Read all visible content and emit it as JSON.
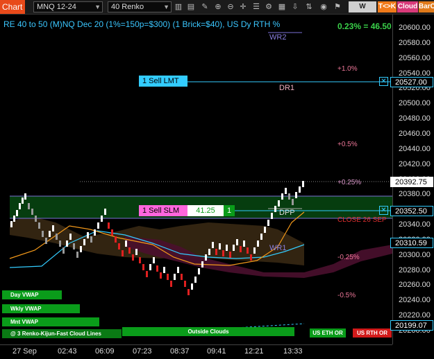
{
  "toolbar": {
    "chart_tab": "Chart",
    "instrument": "MNQ 12-24",
    "bar_type": "40 Renko",
    "buttons": [
      {
        "label": "W VWAP",
        "color": "#cfcfcf"
      },
      {
        "label": "T<>K",
        "color": "#f07a1a"
      },
      {
        "label": "Cloud",
        "color": "#d93a7a"
      },
      {
        "label": "BarC",
        "color": "#e07a1a"
      }
    ]
  },
  "chart": {
    "title": "RE 40 to 50 (M)NQ Dec 20 (1%=150p=$300) (1 Brick=$40), US Dy RTH %",
    "pct_change": "0.23% = 46.50",
    "levels": {
      "wr2": "WR2",
      "dr1": "DR1",
      "dpp": "DPP",
      "wr1": "WR1",
      "close": "CLOSE 26 SEP",
      "p1": "+1.0%",
      "p05": "+0.5%",
      "p025": "+0.25%",
      "m025": "-0.25%",
      "m05": "-0.5%"
    },
    "orders": {
      "sell_lmt": "1 Sell LMT",
      "sell_slm": "1 Sell SLM",
      "slm_value": "41.25",
      "slm_qty": "1"
    },
    "vwap_buttons": [
      "Day VWAP",
      "Wkly VWAP",
      "Mnt VWAP"
    ],
    "outside_clouds": "Outside Clouds",
    "cloud_lines": "@ 3 Renko-Kijun-Fast Cloud Lines",
    "us_eth_or": "US ETH OR",
    "us_rth_or": "US RTH OR"
  },
  "yaxis": {
    "ticks": [
      "20600.00",
      "20580.00",
      "20560.00",
      "20540.00",
      "20520.00",
      "20500.00",
      "20480.00",
      "20460.00",
      "20440.00",
      "20420.00",
      "20400.00",
      "20380.00",
      "20360.00",
      "20340.00",
      "20320.00",
      "20300.00",
      "20280.00",
      "20260.00",
      "20240.00",
      "20220.00",
      "20200.00"
    ],
    "labels": {
      "sell_lmt_price": "20527.00",
      "last_price": "20392.75",
      "sell_slm_price": "20352.50",
      "kijun_price": "20310.59",
      "lower_price": "20199.07"
    }
  },
  "xaxis": {
    "ticks": [
      "27 Sep",
      "02:43",
      "06:09",
      "07:23",
      "08:37",
      "09:41",
      "12:21",
      "13:33"
    ]
  },
  "colors": {
    "accent_cyan": "#33ccff",
    "up_brick": "#ffffff",
    "down_brick": "#e02020",
    "green": "#0a9c1a"
  }
}
